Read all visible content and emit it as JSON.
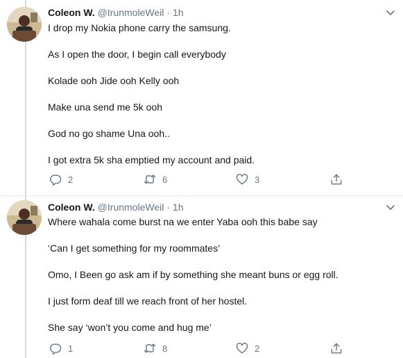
{
  "colors": {
    "text": "#14171a",
    "secondary": "#657786",
    "divider": "#e6ecf0",
    "thread_line": "#cfd9de"
  },
  "tweets": [
    {
      "author_name": "Coleon W.",
      "handle": "@IrunmoleWeil",
      "separator": "·",
      "time": "1h",
      "paragraphs": [
        "I drop my Nokia phone carry the samsung.",
        "As I open the door, I begin call everybody",
        "Kolade ooh Jide ooh Kelly ooh",
        "Make una send me 5k ooh",
        "God no go shame Una ooh..",
        "I got extra 5k sha emptied my account and paid."
      ],
      "replies": "2",
      "retweets": "6",
      "likes": "3",
      "icons": {
        "reply": "reply-icon",
        "retweet": "retweet-icon",
        "like": "heart-icon",
        "share": "share-icon",
        "menu": "chevron-down-icon"
      }
    },
    {
      "author_name": "Coleon W.",
      "handle": "@IrunmoleWeil",
      "separator": "·",
      "time": "1h",
      "paragraphs": [
        "Where wahala come burst na we enter Yaba ooh this babe say",
        "‘Can I get something for my roommates’",
        "Omo, I Been go ask am if by something she meant buns or egg roll.",
        "I just form deaf till we reach front of her hostel.",
        "She say ‘won’t you come and hug me’"
      ],
      "replies": "1",
      "retweets": "8",
      "likes": "2",
      "icons": {
        "reply": "reply-icon",
        "retweet": "retweet-icon",
        "like": "heart-icon",
        "share": "share-icon",
        "menu": "chevron-down-icon"
      }
    }
  ]
}
